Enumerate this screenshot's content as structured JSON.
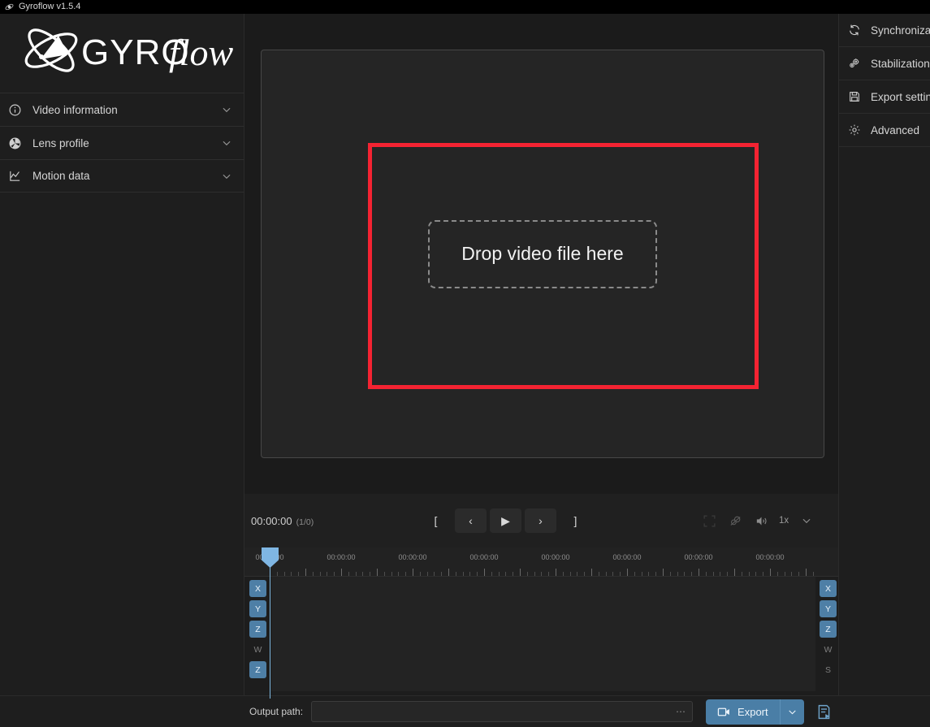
{
  "window": {
    "title": "Gyroflow v1.5.4",
    "icon": "gyroflow-app-icon"
  },
  "left_sidebar": {
    "logo_text": "GYROflow",
    "items": [
      {
        "label": "Video information",
        "icon": "info-circle-icon",
        "expanded": false
      },
      {
        "label": "Lens profile",
        "icon": "aperture-icon",
        "expanded": false
      },
      {
        "label": "Motion data",
        "icon": "motion-chart-icon",
        "expanded": false
      }
    ]
  },
  "right_sidebar": {
    "items": [
      {
        "label": "Synchronization",
        "icon": "sync-refresh-icon"
      },
      {
        "label": "Stabilization",
        "icon": "gears-icon"
      },
      {
        "label": "Export settings",
        "icon": "floppy-save-icon"
      },
      {
        "label": "Advanced",
        "icon": "gear-icon"
      }
    ]
  },
  "preview": {
    "dropzone_text": "Drop video file here",
    "highlight_color": "#f42332"
  },
  "playback": {
    "timecode": "00:00:00",
    "frame_counter": "(1/0)",
    "transport": [
      {
        "label": "[",
        "name": "set-trim-start-button"
      },
      {
        "label": "‹",
        "name": "previous-frame-button"
      },
      {
        "label": "▶",
        "name": "play-button"
      },
      {
        "label": "›",
        "name": "next-frame-button"
      },
      {
        "label": "]",
        "name": "set-trim-end-button"
      }
    ],
    "right_icons": [
      {
        "name": "fullscreen-icon"
      },
      {
        "name": "stabilization-toggle-icon"
      },
      {
        "name": "volume-icon"
      }
    ],
    "speed_label": "1x"
  },
  "timeline": {
    "tick_labels": [
      "00:00:00",
      "00:00:00",
      "00:00:00",
      "00:00:00",
      "00:00:00",
      "00:00:00",
      "00:00:00",
      "00:00:00",
      "00:00:00"
    ],
    "left_tracks": [
      {
        "label": "X",
        "active": true
      },
      {
        "label": "Y",
        "active": true
      },
      {
        "label": "Z",
        "active": true
      },
      {
        "label": "W",
        "active": false
      },
      {
        "label": "Z",
        "active": true
      }
    ],
    "right_tracks": [
      {
        "label": "X",
        "active": true
      },
      {
        "label": "Y",
        "active": true
      },
      {
        "label": "Z",
        "active": true
      },
      {
        "label": "W",
        "active": false
      },
      {
        "label": "S",
        "active": false
      }
    ],
    "playhead_color": "#7fb6e3"
  },
  "bottom_bar": {
    "output_path_label": "Output path:",
    "output_path_value": "",
    "output_path_placeholder": "",
    "browse_label": "⋯",
    "export_label": "Export",
    "export_icon": "video-camera-icon",
    "dropdown_icon": "chevron-down-icon",
    "queue_icon": "render-queue-icon",
    "accent_color": "#4a7ea6"
  }
}
